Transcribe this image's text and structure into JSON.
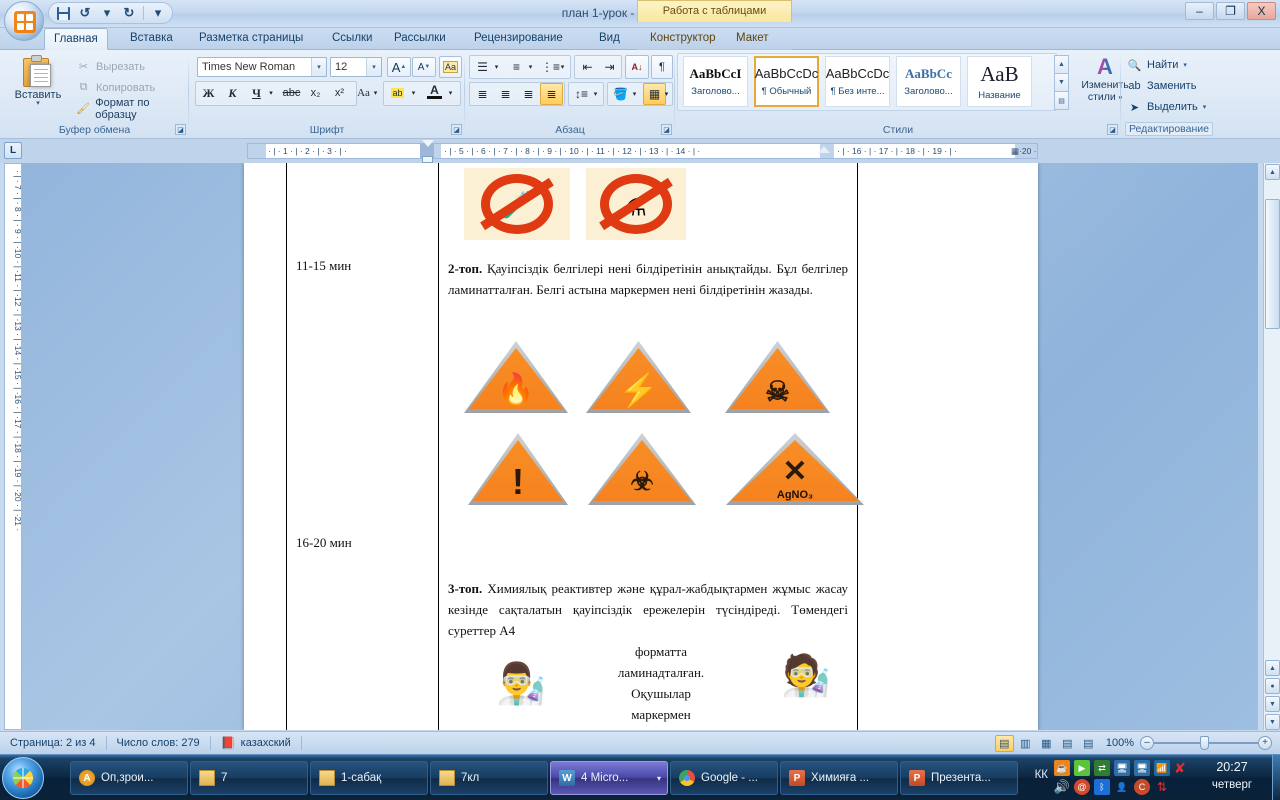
{
  "window": {
    "title": "план 1-урок - Microsoft Word",
    "contextual_tab_title": "Работа с таблицами",
    "minimize": "–",
    "maximize": "❐",
    "close": "X",
    "help": "?"
  },
  "quick_access": {
    "save": "save-icon",
    "undo": "↺",
    "redo": "↻",
    "customize": "▾"
  },
  "ribbon": {
    "tabs": [
      {
        "label": "Главная",
        "active": true
      },
      {
        "label": "Вставка",
        "active": false
      },
      {
        "label": "Разметка страницы",
        "active": false
      },
      {
        "label": "Ссылки",
        "active": false
      },
      {
        "label": "Рассылки",
        "active": false
      },
      {
        "label": "Рецензирование",
        "active": false
      },
      {
        "label": "Вид",
        "active": false
      },
      {
        "label": "Конструктор",
        "active": false,
        "contextual": true
      },
      {
        "label": "Макет",
        "active": false,
        "contextual": true
      }
    ],
    "clipboard": {
      "group_label": "Буфер обмена",
      "paste_label": "Вставить",
      "cut_label": "Вырезать",
      "copy_label": "Копировать",
      "format_painter_label": "Формат по образцу"
    },
    "font": {
      "group_label": "Шрифт",
      "font_family": "Times New Roman",
      "font_size": "12",
      "grow_font": "A",
      "shrink_font": "A",
      "clear_formatting": "Aa",
      "bold": "Ж",
      "italic": "К",
      "underline": "Ч",
      "strikethrough": "abc",
      "subscript": "x₂",
      "superscript": "x²",
      "change_case": "Aa",
      "highlight": "ab",
      "font_color": "A"
    },
    "paragraph": {
      "group_label": "Абзац",
      "bullets": "bullet-list-icon",
      "numbering": "numbered-list-icon",
      "multilevel": "multilevel-list-icon",
      "decrease_indent": "decrease-indent-icon",
      "increase_indent": "increase-indent-icon",
      "sort": "sort-icon",
      "show_marks": "¶",
      "align_left": "align-left-icon",
      "align_center": "align-center-icon",
      "align_right": "align-right-icon",
      "justify": "justify-icon",
      "line_spacing": "line-spacing-icon",
      "shading": "shading-icon",
      "borders": "borders-icon"
    },
    "styles": {
      "group_label": "Стили",
      "change_styles_label": "Изменить\nстили",
      "change_styles_line1": "Изменить",
      "change_styles_line2": "стили",
      "items": [
        {
          "preview": "AaBbCcI",
          "name": "Заголово...",
          "selected": false,
          "serif": true,
          "bold": true
        },
        {
          "preview": "AaBbCcDc",
          "name": "¶ Обычный",
          "selected": true,
          "serif": false,
          "bold": false
        },
        {
          "preview": "AaBbCcDc",
          "name": "¶ Без инте...",
          "selected": false,
          "serif": false,
          "bold": false
        },
        {
          "preview": "AaBbCc",
          "name": "Заголово...",
          "selected": false,
          "serif": true,
          "bold": true
        },
        {
          "preview": "АаВ",
          "name": "Название",
          "selected": false,
          "serif": true,
          "bold": false
        }
      ]
    },
    "editing": {
      "group_label": "Редактирование",
      "find_label": "Найти",
      "replace_label": "Заменить",
      "select_label": "Выделить"
    }
  },
  "ruler": {
    "tab_stop_selector": "L",
    "horizontal_ticks": [
      "1",
      "2",
      "3",
      "5",
      "6",
      "7",
      "8",
      "9",
      "10",
      "11",
      "12",
      "13",
      "14",
      "16",
      "17",
      "18",
      "19",
      "20"
    ],
    "vertical_ticks": [
      "7",
      "8",
      "9",
      "10",
      "11",
      "12",
      "13",
      "14",
      "15",
      "16",
      "17",
      "18",
      "19",
      "20",
      "21"
    ]
  },
  "document": {
    "rows": [
      {
        "time": "11-15 мин",
        "lead": "2-топ.",
        "text": " Қауіпсіздік белгілері нені білдіретінін анықтайды. Бұл белгілер ламинатталған. Белгі астына маркермен нені білдіретінін жазады."
      },
      {
        "time": "16-20 мин",
        "lead": "3-топ.",
        "text": " Химиялық реактивтер және құрал-жабдықтармен жұмыс жасау кезінде сақталатын қауіпсіздік ережелерін түсіндіреді. Төмендегі суреттер А4"
      }
    ],
    "wrapped_lines": [
      "форматта",
      "ламинадталған.",
      "Оқушылар",
      "маркермен"
    ],
    "prohibition_signs": [
      {
        "name": "no-pouring-chemicals-sign"
      },
      {
        "name": "no-heating-flask-sign"
      }
    ],
    "hazard_signs": [
      {
        "name": "flammable-sign",
        "glyph": "🔥",
        "label": ""
      },
      {
        "name": "electricity-sign",
        "glyph": "⚡",
        "label": ""
      },
      {
        "name": "toxic-skull-sign",
        "glyph": "☠",
        "label": ""
      },
      {
        "name": "warning-exclamation-sign",
        "glyph": "!",
        "label": ""
      },
      {
        "name": "corrosive-sign",
        "glyph": "✍",
        "label": ""
      },
      {
        "name": "silver-nitrate-sign",
        "glyph": "✕",
        "label": "AgNO₃"
      }
    ]
  },
  "status_bar": {
    "page": "Страница: 2 из 4",
    "word_count": "Число слов: 279",
    "language": "казахский",
    "proofing_icon": "proofing-errors-icon",
    "zoom": "100%",
    "views": [
      {
        "name": "print-layout-view",
        "glyph": "▤",
        "selected": true
      },
      {
        "name": "full-screen-reading-view",
        "glyph": "▥",
        "selected": false
      },
      {
        "name": "web-layout-view",
        "glyph": "▦",
        "selected": false
      },
      {
        "name": "outline-view",
        "glyph": "▤",
        "selected": false
      },
      {
        "name": "draft-view",
        "glyph": "▤",
        "selected": false
      }
    ],
    "zoom_out": "–",
    "zoom_in": "+"
  },
  "taskbar": {
    "start": "start-button",
    "buttons": [
      {
        "label": "Оп,зрои...",
        "icon": "amber-app-icon",
        "active": false
      },
      {
        "label": "7",
        "icon": "folder-icon",
        "active": false
      },
      {
        "label": "1-сабақ",
        "icon": "folder-icon",
        "active": false
      },
      {
        "label": "7кл",
        "icon": "folder-icon",
        "active": false
      },
      {
        "label": "4 Micro...",
        "icon": "word-icon",
        "active": true,
        "has_arrow": true
      },
      {
        "label": "Google - ...",
        "icon": "chrome-icon",
        "active": false
      },
      {
        "label": "Химияға ...",
        "icon": "powerpoint-icon",
        "active": false
      },
      {
        "label": "Презента...",
        "icon": "powerpoint-icon",
        "active": false
      }
    ],
    "language_indicator": "КК",
    "tray_icons": [
      "java-icon",
      "media-play-icon",
      "network-transfer-icon",
      "monitor-error-icon",
      "monitor-error2-icon",
      "network-icon",
      "red-slash-icon",
      "volume-icon",
      "at-icon",
      "bluetooth-icon",
      "user-icon",
      "ccleaner-icon",
      "updates-icon"
    ],
    "clock_time": "20:27",
    "clock_day": "четверг"
  },
  "colors": {
    "accent_orange": "#f5821f",
    "ribbon_blue": "#dfeaf6",
    "title_blue": "#c4d7ef",
    "taskbar_dark": "#0c2640",
    "selected_gold": "#ffcd5c"
  }
}
